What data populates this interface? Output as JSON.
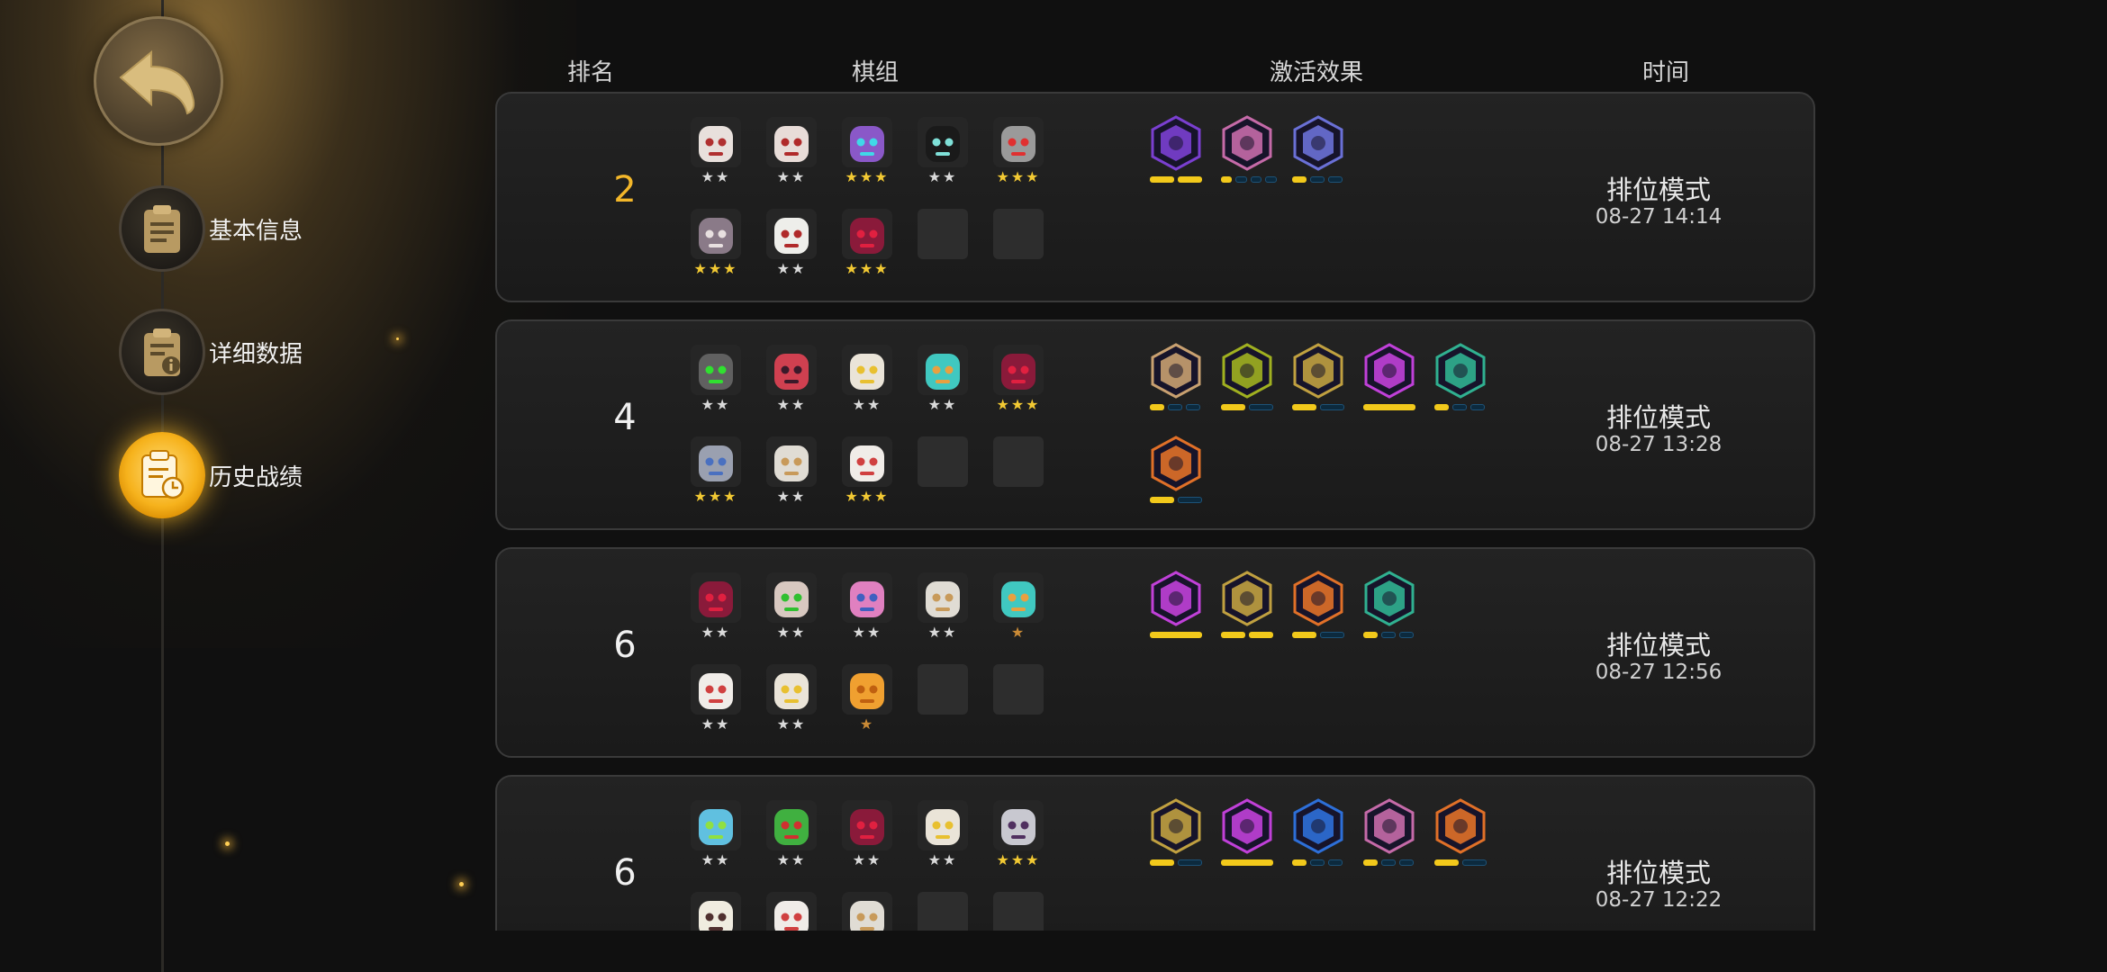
{
  "nav": {
    "back_icon": "back-arrow-icon",
    "items": [
      {
        "label": "基本信息",
        "icon": "clipboard-icon",
        "active": false
      },
      {
        "label": "详细数据",
        "icon": "info-document-icon",
        "active": false
      },
      {
        "label": "历史战绩",
        "icon": "history-clock-icon",
        "active": true
      }
    ]
  },
  "headers": {
    "rank": "排名",
    "lineup": "棋组",
    "traits": "激活效果",
    "time": "时间"
  },
  "colors": {
    "accent_gold": "#f3b72a",
    "star_gold": "#f2c933",
    "pip_on": "#f2c91b",
    "pip_off": "#0c2a3e"
  },
  "records": [
    {
      "rank": "2",
      "mode": "排位模式",
      "time": "08-27 14:14",
      "units": [
        {
          "icon": "fox-mask-icon",
          "stars": "★★",
          "tier": "silver"
        },
        {
          "icon": "bloody-fang-icon",
          "stars": "★★",
          "tier": "silver"
        },
        {
          "icon": "purple-bat-icon",
          "stars": "★★★",
          "tier": "gold"
        },
        {
          "icon": "black-hood-icon",
          "stars": "★★",
          "tier": "silver"
        },
        {
          "icon": "grey-skull-icon",
          "stars": "★★★",
          "tier": "gold"
        },
        {
          "icon": "hooded-elder-icon",
          "stars": "★★★",
          "tier": "gold"
        },
        {
          "icon": "white-skull-icon",
          "stars": "★★",
          "tier": "silver"
        },
        {
          "icon": "red-demon-icon",
          "stars": "★★★",
          "tier": "gold"
        }
      ],
      "empty_slots": 2,
      "traits": [
        {
          "icon": "dark-knight-trait-icon",
          "color": "#7a3fd0",
          "pips": [
            1,
            1
          ]
        },
        {
          "icon": "pink-knight-trait-icon",
          "color": "#c56aa8",
          "pips": [
            1,
            0,
            0,
            0
          ]
        },
        {
          "icon": "laptop-trait-icon",
          "color": "#6a70d6",
          "pips": [
            1,
            0,
            0
          ]
        }
      ]
    },
    {
      "rank": "4",
      "mode": "排位模式",
      "time": "08-27 13:28",
      "units": [
        {
          "icon": "green-orb-robot-icon",
          "stars": "★★",
          "tier": "silver"
        },
        {
          "icon": "red-ogre-icon",
          "stars": "★★",
          "tier": "silver"
        },
        {
          "icon": "straw-hat-icon",
          "stars": "★★",
          "tier": "silver"
        },
        {
          "icon": "teal-robot-icon",
          "stars": "★★",
          "tier": "silver"
        },
        {
          "icon": "red-demon-icon",
          "stars": "★★★",
          "tier": "gold"
        },
        {
          "icon": "armored-knight-icon",
          "stars": "★★★",
          "tier": "gold"
        },
        {
          "icon": "patched-ghost-icon",
          "stars": "★★",
          "tier": "silver"
        },
        {
          "icon": "white-beard-icon",
          "stars": "★★★",
          "tier": "gold"
        }
      ],
      "empty_slots": 2,
      "traits": [
        {
          "icon": "axe-trait-icon",
          "color": "#c8a070",
          "pips": [
            1,
            0,
            0
          ]
        },
        {
          "icon": "tri-orb-trait-icon",
          "color": "#a0b020",
          "pips": [
            1,
            0
          ]
        },
        {
          "icon": "claw-trait-icon",
          "color": "#c0a040",
          "pips": [
            1,
            0
          ]
        },
        {
          "icon": "demon-trait-icon",
          "color": "#c040d8",
          "pips": [
            1
          ]
        },
        {
          "icon": "paw-trait-icon",
          "color": "#30b090",
          "pips": [
            1,
            0,
            0
          ]
        },
        {
          "icon": "leaf-trait-icon",
          "color": "#e07028",
          "pips": [
            1,
            0
          ]
        }
      ]
    },
    {
      "rank": "6",
      "mode": "排位模式",
      "time": "08-27 12:56",
      "units": [
        {
          "icon": "red-demon-icon",
          "stars": "★★",
          "tier": "silver"
        },
        {
          "icon": "horned-beast-icon",
          "stars": "★★",
          "tier": "silver"
        },
        {
          "icon": "pink-hair-icon",
          "stars": "★★",
          "tier": "silver"
        },
        {
          "icon": "patched-ghost-icon",
          "stars": "★★",
          "tier": "silver"
        },
        {
          "icon": "teal-robot-icon",
          "stars": "★",
          "tier": "bronze"
        },
        {
          "icon": "white-beard-icon",
          "stars": "★★",
          "tier": "silver"
        },
        {
          "icon": "straw-hat-icon",
          "stars": "★★",
          "tier": "silver"
        },
        {
          "icon": "orange-paw-icon",
          "stars": "★",
          "tier": "bronze"
        }
      ],
      "empty_slots": 2,
      "traits": [
        {
          "icon": "demon-trait-icon",
          "color": "#c040d8",
          "pips": [
            1
          ]
        },
        {
          "icon": "claw-trait-icon",
          "color": "#c0a040",
          "pips": [
            1,
            1
          ]
        },
        {
          "icon": "leaf-trait-icon",
          "color": "#e07028",
          "pips": [
            1,
            0
          ]
        },
        {
          "icon": "paw-trait-icon",
          "color": "#30b090",
          "pips": [
            1,
            0,
            0
          ]
        }
      ]
    },
    {
      "rank": "6",
      "mode": "排位模式",
      "time": "08-27 12:22",
      "units": [
        {
          "icon": "green-frog-bot-icon",
          "stars": "★★",
          "tier": "silver"
        },
        {
          "icon": "goggles-orc-icon",
          "stars": "★★",
          "tier": "silver"
        },
        {
          "icon": "red-demon-icon",
          "stars": "★★",
          "tier": "silver"
        },
        {
          "icon": "straw-hat-icon",
          "stars": "★★",
          "tier": "silver"
        },
        {
          "icon": "samurai-icon",
          "stars": "★★★",
          "tier": "gold"
        },
        {
          "icon": "yeti-icon",
          "stars": "",
          "tier": "silver"
        },
        {
          "icon": "white-beard-icon",
          "stars": "",
          "tier": "silver"
        },
        {
          "icon": "patched-ghost-icon",
          "stars": "",
          "tier": "silver"
        }
      ],
      "empty_slots": 2,
      "traits": [
        {
          "icon": "claw-trait-icon",
          "color": "#c0a040",
          "pips": [
            1,
            0
          ]
        },
        {
          "icon": "demon-trait-icon",
          "color": "#c040d8",
          "pips": [
            1
          ]
        },
        {
          "icon": "carrot-trait-icon",
          "color": "#2d6fd8",
          "pips": [
            1,
            0,
            0
          ]
        },
        {
          "icon": "pink-knight-trait-icon",
          "color": "#c56aa8",
          "pips": [
            1,
            0,
            0
          ]
        },
        {
          "icon": "leaf-trait-icon",
          "color": "#e07028",
          "pips": [
            1,
            0
          ]
        }
      ]
    }
  ]
}
